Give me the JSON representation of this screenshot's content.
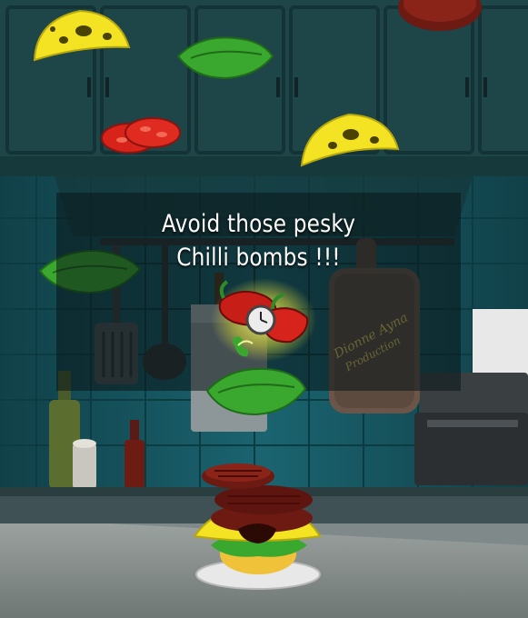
{
  "tip": {
    "line1": "Avoid those pesky",
    "line2": "Chilli bombs !!!"
  },
  "cutting_board_signature": "Dionne Ayna Production",
  "colors": {
    "cabinet": "#1f4a4d",
    "tile": "#16505a",
    "counter": "#8c9493",
    "cheese": "#f4e322",
    "lettuce": "#3aa82e",
    "tomato": "#d8231b",
    "patty": "#6d1a12",
    "chili": "#c81e18"
  },
  "icons": {
    "powerup": "chilli-bomb-clock-icon"
  }
}
